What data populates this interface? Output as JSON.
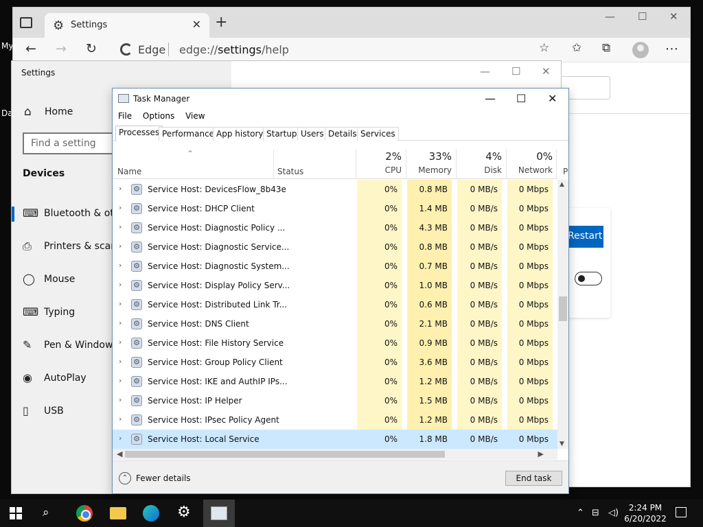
{
  "desktop": {
    "label_1": "My",
    "label_2": "Da"
  },
  "edge": {
    "tab_title": "Settings",
    "address_brand": "Edge",
    "address_scheme": "edge://",
    "address_host": "settings",
    "address_path": "/help",
    "restart_label": "Restart"
  },
  "settings": {
    "window_title": "Settings",
    "home_label": "Home",
    "search_placeholder": "Find a setting",
    "section_title": "Devices",
    "nav": [
      {
        "label": "Bluetooth & other devices",
        "icon": "bluetooth-devices-icon"
      },
      {
        "label": "Printers & scanners",
        "icon": "printer-icon"
      },
      {
        "label": "Mouse",
        "icon": "mouse-icon"
      },
      {
        "label": "Typing",
        "icon": "keyboard-icon"
      },
      {
        "label": "Pen & Windows Ink",
        "icon": "pen-icon"
      },
      {
        "label": "AutoPlay",
        "icon": "autoplay-icon"
      },
      {
        "label": "USB",
        "icon": "usb-icon"
      }
    ]
  },
  "taskmgr": {
    "title": "Task Manager",
    "menu": [
      "File",
      "Options",
      "View"
    ],
    "tabs": [
      "Processes",
      "Performance",
      "App history",
      "Startup",
      "Users",
      "Details",
      "Services"
    ],
    "columns": {
      "name": "Name",
      "status": "Status",
      "cpu": {
        "pct": "2%",
        "label": "CPU"
      },
      "memory": {
        "pct": "33%",
        "label": "Memory"
      },
      "disk": {
        "pct": "4%",
        "label": "Disk"
      },
      "network": {
        "pct": "0%",
        "label": "Network"
      },
      "extra": "P"
    },
    "rows": [
      {
        "name": "Service Host: DevicesFlow_8b43e",
        "cpu": "0%",
        "memory": "0.8 MB",
        "disk": "0 MB/s",
        "network": "0 Mbps"
      },
      {
        "name": "Service Host: DHCP Client",
        "cpu": "0%",
        "memory": "1.4 MB",
        "disk": "0 MB/s",
        "network": "0 Mbps"
      },
      {
        "name": "Service Host: Diagnostic Policy ...",
        "cpu": "0%",
        "memory": "4.3 MB",
        "disk": "0 MB/s",
        "network": "0 Mbps"
      },
      {
        "name": "Service Host: Diagnostic Service...",
        "cpu": "0%",
        "memory": "0.8 MB",
        "disk": "0 MB/s",
        "network": "0 Mbps"
      },
      {
        "name": "Service Host: Diagnostic System...",
        "cpu": "0%",
        "memory": "0.7 MB",
        "disk": "0 MB/s",
        "network": "0 Mbps"
      },
      {
        "name": "Service Host: Display Policy Serv...",
        "cpu": "0%",
        "memory": "1.0 MB",
        "disk": "0 MB/s",
        "network": "0 Mbps"
      },
      {
        "name": "Service Host: Distributed Link Tr...",
        "cpu": "0%",
        "memory": "0.6 MB",
        "disk": "0 MB/s",
        "network": "0 Mbps"
      },
      {
        "name": "Service Host: DNS Client",
        "cpu": "0%",
        "memory": "2.1 MB",
        "disk": "0 MB/s",
        "network": "0 Mbps"
      },
      {
        "name": "Service Host: File History Service",
        "cpu": "0%",
        "memory": "0.9 MB",
        "disk": "0 MB/s",
        "network": "0 Mbps"
      },
      {
        "name": "Service Host: Group Policy Client",
        "cpu": "0%",
        "memory": "3.6 MB",
        "disk": "0 MB/s",
        "network": "0 Mbps"
      },
      {
        "name": "Service Host: IKE and AuthIP IPs...",
        "cpu": "0%",
        "memory": "1.2 MB",
        "disk": "0 MB/s",
        "network": "0 Mbps"
      },
      {
        "name": "Service Host: IP Helper",
        "cpu": "0%",
        "memory": "1.5 MB",
        "disk": "0 MB/s",
        "network": "0 Mbps"
      },
      {
        "name": "Service Host: IPsec Policy Agent",
        "cpu": "0%",
        "memory": "1.2 MB",
        "disk": "0 MB/s",
        "network": "0 Mbps"
      },
      {
        "name": "Service Host: Local Service",
        "cpu": "0%",
        "memory": "1.8 MB",
        "disk": "0 MB/s",
        "network": "0 Mbps",
        "selected": true
      }
    ],
    "fewer_details": "Fewer details",
    "end_task": "End task"
  },
  "taskbar": {
    "time": "2:24 PM",
    "date": "6/20/2022"
  },
  "colors": {
    "accent": "#0067c0",
    "cpu_heat": "#fff6c8",
    "memory_heat": "#fff0b0",
    "selected_row": "#cce8ff"
  }
}
